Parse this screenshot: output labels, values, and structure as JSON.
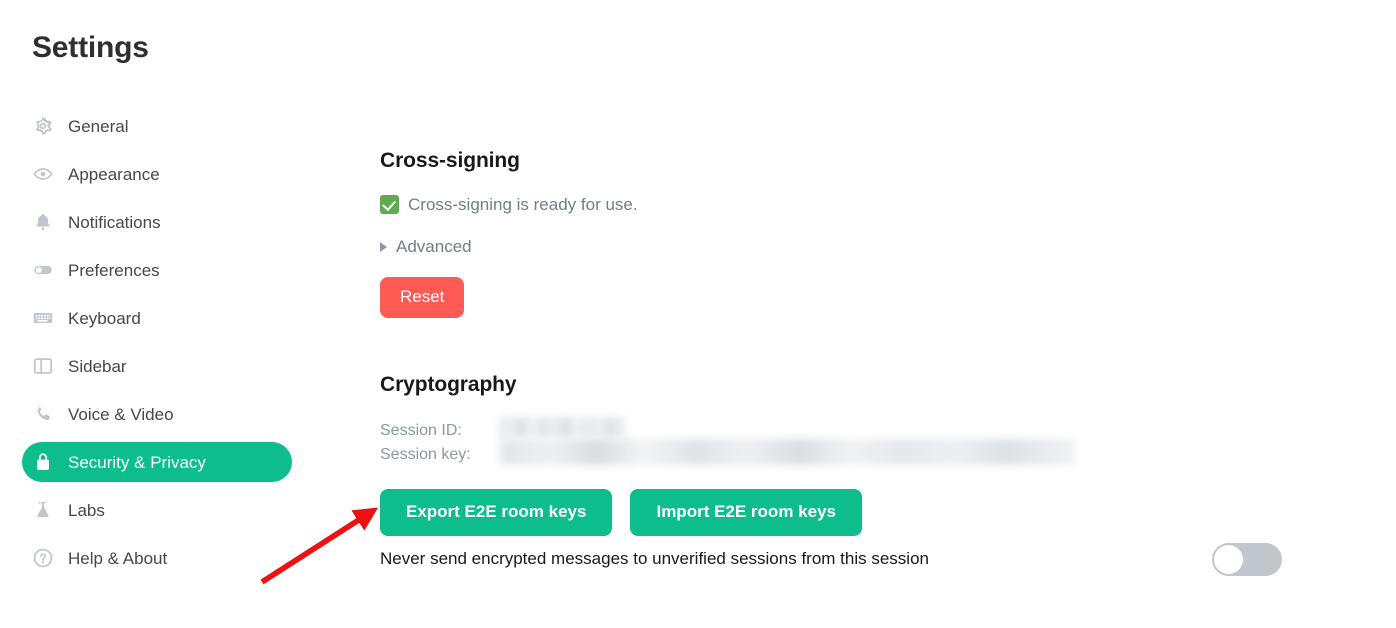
{
  "page": {
    "title": "Settings"
  },
  "sidebar": {
    "items": [
      {
        "label": "General",
        "icon": "gear-icon",
        "selected": false
      },
      {
        "label": "Appearance",
        "icon": "eye-icon",
        "selected": false
      },
      {
        "label": "Notifications",
        "icon": "bell-icon",
        "selected": false
      },
      {
        "label": "Preferences",
        "icon": "toggle-icon",
        "selected": false
      },
      {
        "label": "Keyboard",
        "icon": "keyboard-icon",
        "selected": false
      },
      {
        "label": "Sidebar",
        "icon": "sidebar-icon",
        "selected": false
      },
      {
        "label": "Voice & Video",
        "icon": "phone-icon",
        "selected": false
      },
      {
        "label": "Security & Privacy",
        "icon": "lock-icon",
        "selected": true
      },
      {
        "label": "Labs",
        "icon": "flask-icon",
        "selected": false
      },
      {
        "label": "Help & About",
        "icon": "help-icon",
        "selected": false
      }
    ]
  },
  "cross_signing": {
    "heading": "Cross-signing",
    "status_text": "Cross-signing is ready for use.",
    "status_icon": "green-check-emoji",
    "advanced_label": "Advanced",
    "advanced_expanded": false,
    "reset_label": "Reset"
  },
  "cryptography": {
    "heading": "Cryptography",
    "session_id_label": "Session ID:",
    "session_id_value": "",
    "session_id_redacted": true,
    "session_key_label": "Session key:",
    "session_key_value": "",
    "session_key_redacted": true,
    "export_label": "Export E2E room keys",
    "import_label": "Import E2E room keys"
  },
  "unverified_sessions": {
    "label": "Never send encrypted messages to unverified sessions from this session",
    "toggle_state": "off"
  },
  "annotation": {
    "type": "arrow",
    "color": "#ee1111",
    "points_to": "Export E2E room keys"
  },
  "colors": {
    "brand_green": "#0dbd8b",
    "danger_red": "#ff5b55",
    "annotation_red": "#ee1111",
    "check_green": "#5fab50",
    "muted_text": "#8d97a5",
    "toggle_off": "#c1c6cd",
    "background": "#ffffff"
  }
}
